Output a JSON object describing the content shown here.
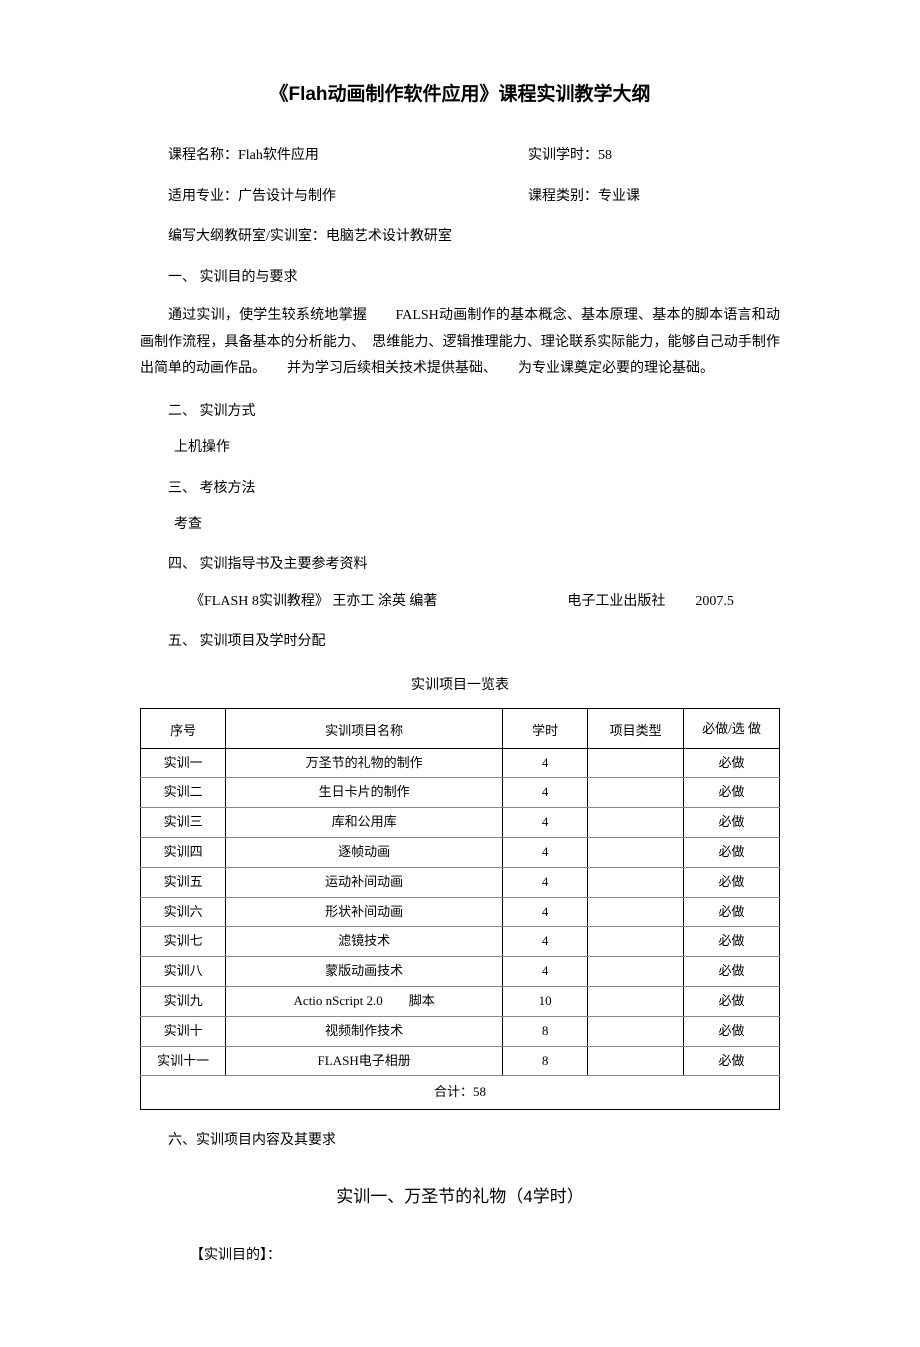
{
  "title": "《Flah动画制作软件应用》课程实训教学大纲",
  "meta": {
    "course_name_label": "课程名称：Flah软件应用",
    "hours_label": "实训学时：58",
    "major_label": "适用专业：广告设计与制作",
    "category_label": "课程类别：专业课",
    "office_label": "编写大纲教研室/实训室：电脑艺术设计教研室"
  },
  "sections": {
    "s1_head": "一、 实训目的与要求",
    "s1_body": "通过实训，使学生较系统地掌握　　FALSH动画制作的基本概念、基本原理、基本的脚本语言和动画制作流程，具备基本的分析能力、　思维能力、逻辑推理能力、理论联系实际能力，能够自己动手制作出简单的动画作品。　　并为学习后续相关技术提供基础、　　为专业课奠定必要的理论基础。",
    "s2_head": "二、 实训方式",
    "s2_body": "上机操作",
    "s3_head": "三、 考核方法",
    "s3_body": "考查",
    "s4_head": "四、 实训指导书及主要参考资料",
    "s4_ref_book": "《FLASH 8实训教程》 王亦工  涂英  编著",
    "s4_ref_pub": "电子工业出版社",
    "s4_ref_date": "2007.5",
    "s5_head": "五、 实训项目及学时分配",
    "table_caption": "实训项目一览表",
    "s6_head": "六、实训项目内容及其要求"
  },
  "table": {
    "headers": {
      "idx": "序号",
      "name": "实训项目名称",
      "hours": "学时",
      "type": "项目类型",
      "req": "必做/选 做"
    },
    "rows": [
      {
        "idx": "实训一",
        "name": "万圣节的礼物的制作",
        "hours": "4",
        "type": "",
        "req": "必做"
      },
      {
        "idx": "实训二",
        "name": "生日卡片的制作",
        "hours": "4",
        "type": "",
        "req": "必做"
      },
      {
        "idx": "实训三",
        "name": "库和公用库",
        "hours": "4",
        "type": "",
        "req": "必做"
      },
      {
        "idx": "实训四",
        "name": "逐帧动画",
        "hours": "4",
        "type": "",
        "req": "必做"
      },
      {
        "idx": "实训五",
        "name": "运动补间动画",
        "hours": "4",
        "type": "",
        "req": "必做"
      },
      {
        "idx": "实训六",
        "name": "形状补间动画",
        "hours": "4",
        "type": "",
        "req": "必做"
      },
      {
        "idx": "实训七",
        "name": "滤镜技术",
        "hours": "4",
        "type": "",
        "req": "必做"
      },
      {
        "idx": "实训八",
        "name": "蒙版动画技术",
        "hours": "4",
        "type": "",
        "req": "必做"
      },
      {
        "idx": "实训九",
        "name": "Actio nScript 2.0　　脚本",
        "hours": "10",
        "type": "",
        "req": "必做"
      },
      {
        "idx": "实训十",
        "name": "视频制作技术",
        "hours": "8",
        "type": "",
        "req": "必做"
      },
      {
        "idx": "实训十一",
        "name": "FLASH电子相册",
        "hours": "8",
        "type": "",
        "req": "必做"
      }
    ],
    "total": "合计：58"
  },
  "sub": {
    "title": "实训一、万圣节的礼物（4学时）",
    "obj_head": "【实训目的】："
  }
}
